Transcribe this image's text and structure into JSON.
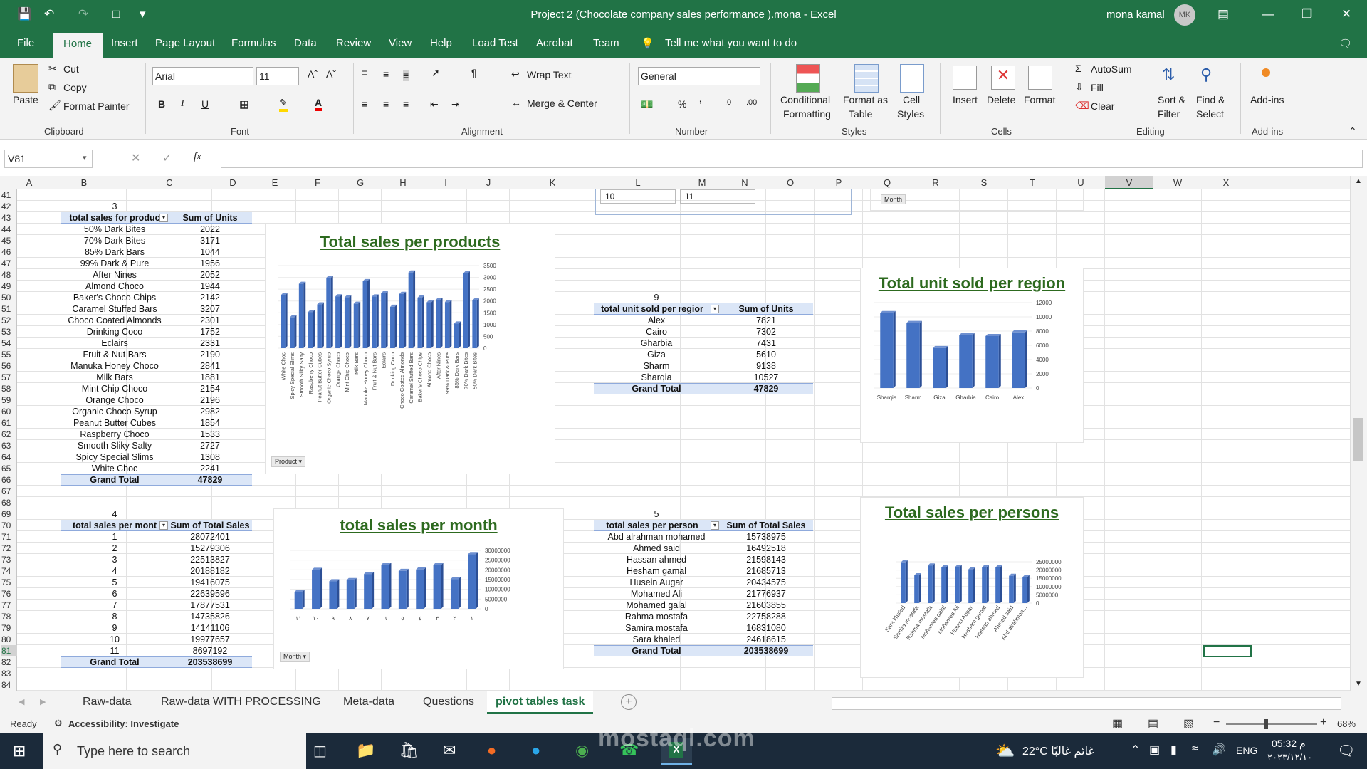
{
  "window": {
    "title": "Project 2 (Chocolate company sales performance ).mona  -  Excel",
    "user": "mona kamal",
    "avatar_initials": "MK"
  },
  "menu": {
    "file": "File",
    "home": "Home",
    "insert": "Insert",
    "page_layout": "Page Layout",
    "formulas": "Formulas",
    "data": "Data",
    "review": "Review",
    "view": "View",
    "help": "Help",
    "load_test": "Load Test",
    "acrobat": "Acrobat",
    "team": "Team",
    "tell_me": "Tell me what you want to do"
  },
  "ribbon": {
    "clipboard": {
      "paste": "Paste",
      "cut": "Cut",
      "copy": "Copy",
      "format_painter": "Format Painter",
      "label": "Clipboard"
    },
    "font": {
      "name": "Arial",
      "size": "11",
      "label": "Font"
    },
    "alignment": {
      "wrap": "Wrap Text",
      "merge": "Merge & Center",
      "label": "Alignment"
    },
    "number": {
      "format": "General",
      "label": "Number"
    },
    "styles": {
      "conditional": "Conditional",
      "formatting": "Formatting",
      "format_as": "Format as",
      "table": "Table",
      "cell": "Cell",
      "cell_styles": "Styles",
      "label": "Styles"
    },
    "cells": {
      "insert": "Insert",
      "delete": "Delete",
      "format": "Format",
      "label": "Cells"
    },
    "editing": {
      "autosum": "AutoSum",
      "fill": "Fill",
      "clear": "Clear",
      "sort": "Sort &",
      "filter": "Filter",
      "find": "Find &",
      "select": "Select",
      "label": "Editing"
    },
    "addins": {
      "addins": "Add-ins",
      "label": "Add-ins"
    }
  },
  "formula_bar": {
    "name_box": "V81",
    "fx": "fx",
    "value": ""
  },
  "columns": [
    "A",
    "B",
    "C",
    "D",
    "E",
    "F",
    "G",
    "H",
    "I",
    "J",
    "K",
    "L",
    "M",
    "N",
    "O",
    "P",
    "Q",
    "R",
    "S",
    "T",
    "U",
    "V",
    "W",
    "X"
  ],
  "rows": [
    "41",
    "42",
    "43",
    "44",
    "45",
    "46",
    "47",
    "48",
    "49",
    "50",
    "51",
    "52",
    "53",
    "54",
    "55",
    "56",
    "57",
    "58",
    "59",
    "60",
    "61",
    "62",
    "63",
    "64",
    "65",
    "66",
    "67",
    "68",
    "69",
    "70",
    "71",
    "72",
    "73",
    "74",
    "75",
    "76",
    "77",
    "78",
    "79",
    "80",
    "81",
    "82",
    "83",
    "84"
  ],
  "top_fragments": {
    "slicer_a": "10",
    "slicer_b": "11",
    "month_button": "Month"
  },
  "pivot_products": {
    "number": "3",
    "header_label": "total sales for produc",
    "header_value": "Sum of Units",
    "rows": [
      [
        "50% Dark Bites",
        "2022"
      ],
      [
        "70% Dark Bites",
        "3171"
      ],
      [
        "85% Dark Bars",
        "1044"
      ],
      [
        "99% Dark & Pure",
        "1956"
      ],
      [
        "After Nines",
        "2052"
      ],
      [
        "Almond Choco",
        "1944"
      ],
      [
        "Baker's Choco Chips",
        "2142"
      ],
      [
        "Caramel Stuffed Bars",
        "3207"
      ],
      [
        "Choco Coated Almonds",
        "2301"
      ],
      [
        "Drinking Coco",
        "1752"
      ],
      [
        "Eclairs",
        "2331"
      ],
      [
        "Fruit & Nut Bars",
        "2190"
      ],
      [
        "Manuka Honey Choco",
        "2841"
      ],
      [
        "Milk Bars",
        "1881"
      ],
      [
        "Mint Chip Choco",
        "2154"
      ],
      [
        "Orange Choco",
        "2196"
      ],
      [
        "Organic Choco Syrup",
        "2982"
      ],
      [
        "Peanut Butter Cubes",
        "1854"
      ],
      [
        "Raspberry Choco",
        "1533"
      ],
      [
        "Smooth Sliky Salty",
        "2727"
      ],
      [
        "Spicy Special Slims",
        "1308"
      ],
      [
        "White Choc",
        "2241"
      ]
    ],
    "total_label": "Grand Total",
    "total_value": "47829"
  },
  "pivot_months": {
    "number": "4",
    "header_label": "total sales per mont",
    "header_value": "Sum of Total Sales",
    "rows": [
      [
        "1",
        "28072401"
      ],
      [
        "2",
        "15279306"
      ],
      [
        "3",
        "22513827"
      ],
      [
        "4",
        "20188182"
      ],
      [
        "5",
        "19416075"
      ],
      [
        "6",
        "22639596"
      ],
      [
        "7",
        "17877531"
      ],
      [
        "8",
        "14735826"
      ],
      [
        "9",
        "14141106"
      ],
      [
        "10",
        "19977657"
      ],
      [
        "11",
        "8697192"
      ]
    ],
    "total_label": "Grand Total",
    "total_value": "203538699"
  },
  "pivot_regions": {
    "number": "9",
    "header_label": "total unit sold per regior",
    "header_value": "Sum of Units",
    "rows": [
      [
        "Alex",
        "7821"
      ],
      [
        "Cairo",
        "7302"
      ],
      [
        "Gharbia",
        "7431"
      ],
      [
        "Giza",
        "5610"
      ],
      [
        "Sharm",
        "9138"
      ],
      [
        "Sharqia",
        "10527"
      ]
    ],
    "total_label": "Grand Total",
    "total_value": "47829"
  },
  "pivot_persons": {
    "number": "5",
    "header_label": "total sales per person",
    "header_value": "Sum of Total Sales",
    "rows": [
      [
        "Abd alrahman mohamed",
        "15738975"
      ],
      [
        "Ahmed said",
        "16492518"
      ],
      [
        "Hassan ahmed",
        "21598143"
      ],
      [
        "Hesham gamal",
        "21685713"
      ],
      [
        "Husein Augar",
        "20434575"
      ],
      [
        "Mohamed Ali",
        "21776937"
      ],
      [
        "Mohamed galal",
        "21603855"
      ],
      [
        "Rahma mostafa",
        "22758288"
      ],
      [
        "Samira mostafa",
        "16831080"
      ],
      [
        "Sara khaled",
        "24618615"
      ]
    ],
    "total_label": "Grand Total",
    "total_value": "203538699"
  },
  "chart_data": [
    {
      "type": "bar",
      "title": "Total sales per products",
      "field_button": "Product",
      "categories": [
        "White Choc",
        "Spicy Special Slims",
        "Smooth Sliky Salty",
        "Raspberry Choco",
        "Peanut Butter Cubes",
        "Organic Choco Syrup",
        "Orange Choco",
        "Mint Chip Choco",
        "Milk Bars",
        "Manuka Honey Choco",
        "Fruit & Nut Bars",
        "Eclairs",
        "Drinking Coco",
        "Choco Coated Almonds",
        "Caramel Stuffed Bars",
        "Baker's Choco Chips",
        "Almond Choco",
        "After Nines",
        "99% Dark & Pure",
        "85% Dark Bars",
        "70% Dark Bites",
        "50% Dark Bites"
      ],
      "values": [
        2241,
        1308,
        2727,
        1533,
        1854,
        2982,
        2196,
        2154,
        1881,
        2841,
        2190,
        2331,
        1752,
        2301,
        3207,
        2142,
        1944,
        2052,
        1956,
        1044,
        3171,
        2022
      ],
      "ylim": [
        0,
        3500
      ],
      "yticks": [
        "3500",
        "3000",
        "2500",
        "2000",
        "1500",
        "1000",
        "500",
        "0"
      ]
    },
    {
      "type": "bar",
      "title": "total sales per month",
      "field_button": "Month",
      "categories": [
        "١١",
        "١٠",
        "٩",
        "٨",
        "٧",
        "٦",
        "٥",
        "٤",
        "٣",
        "٢",
        "١"
      ],
      "values": [
        8697192,
        19977657,
        14141106,
        14735826,
        17877531,
        22639596,
        19416075,
        20188182,
        22513827,
        15279306,
        28072401
      ],
      "ylim": [
        0,
        30000000
      ],
      "yticks": [
        "30000000",
        "25000000",
        "20000000",
        "15000000",
        "10000000",
        "5000000",
        "0"
      ]
    },
    {
      "type": "bar",
      "title": "Total unit sold per region",
      "categories": [
        "Sharqia",
        "Sharm",
        "Giza",
        "Gharbia",
        "Cairo",
        "Alex"
      ],
      "values": [
        10527,
        9138,
        5610,
        7431,
        7302,
        7821
      ],
      "ylim": [
        0,
        12000
      ],
      "yticks": [
        "12000",
        "10000",
        "8000",
        "6000",
        "4000",
        "2000",
        "0"
      ]
    },
    {
      "type": "bar",
      "title": "Total sales per persons",
      "categories": [
        "Sara khaled",
        "Samira mostafa",
        "Rahma mostafa",
        "Mohamed galal",
        "Mohamed Ali",
        "Husein Augar",
        "Hesham gamal",
        "Hassan ahmed",
        "Ahmed said",
        "Abd alrahman..."
      ],
      "values": [
        24618615,
        16831080,
        22758288,
        21603855,
        21776937,
        20434575,
        21685713,
        21598143,
        16492518,
        15738975
      ],
      "ylim": [
        0,
        25000000
      ],
      "yticks": [
        "25000000",
        "20000000",
        "15000000",
        "10000000",
        "5000000",
        "0"
      ]
    }
  ],
  "sheets": [
    "Raw-data",
    "Raw-data WITH PROCESSING",
    "Meta-data",
    "Questions",
    "pivot tables task"
  ],
  "status": {
    "ready": "Ready",
    "accessibility": "Accessibility: Investigate",
    "zoom": "68%"
  },
  "taskbar": {
    "search": "Type here to search",
    "weather": "22°C  غائم غالبًا",
    "lang": "ENG",
    "time": "05:32 م",
    "date": "٢٠٢٣/١٢/١٠"
  },
  "watermark": {
    "text": "mostaql.com"
  },
  "colors": {
    "excel_green": "#217346",
    "bar": "#4472c4",
    "title_green": "#2d6a1f",
    "pivot_header": "#dbe6f7"
  }
}
